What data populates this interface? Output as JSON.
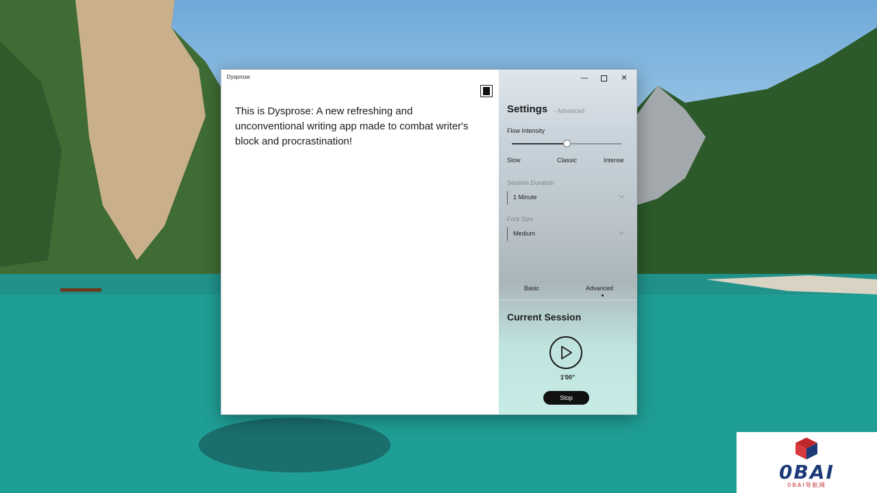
{
  "window": {
    "title": "Dysprose",
    "caption": {
      "minimize": "—",
      "maximize": "",
      "close": "✕"
    }
  },
  "editor": {
    "text": "This is Dysprose: A new refreshing and unconventional writing app made to combat writer's block and procrastination!",
    "theme_toggle_icon": "contrast-toggle-icon"
  },
  "settings": {
    "title": "Settings",
    "subtitle": "- Advanced",
    "flow_intensity": {
      "label": "Flow Intensity",
      "ticks": [
        "Slow",
        "Classic",
        "Intense"
      ],
      "value": 0.5
    },
    "session_duration": {
      "label": "Session Duration",
      "value": "1 Minute"
    },
    "font_size": {
      "label": "Font Size",
      "value": "Medium"
    },
    "tabs": [
      {
        "label": "Basic",
        "selected": false
      },
      {
        "label": "Advanced",
        "selected": true
      }
    ]
  },
  "session": {
    "title": "Current Session",
    "play_icon": "play-icon",
    "timer": "1'00\"",
    "stop_label": "Stop"
  },
  "watermark": {
    "logo_text": "0BAI",
    "sub_text": "0BAI导航网"
  },
  "colors": {
    "watermark_blue": "#1c3a78",
    "watermark_red": "#c0272d"
  }
}
